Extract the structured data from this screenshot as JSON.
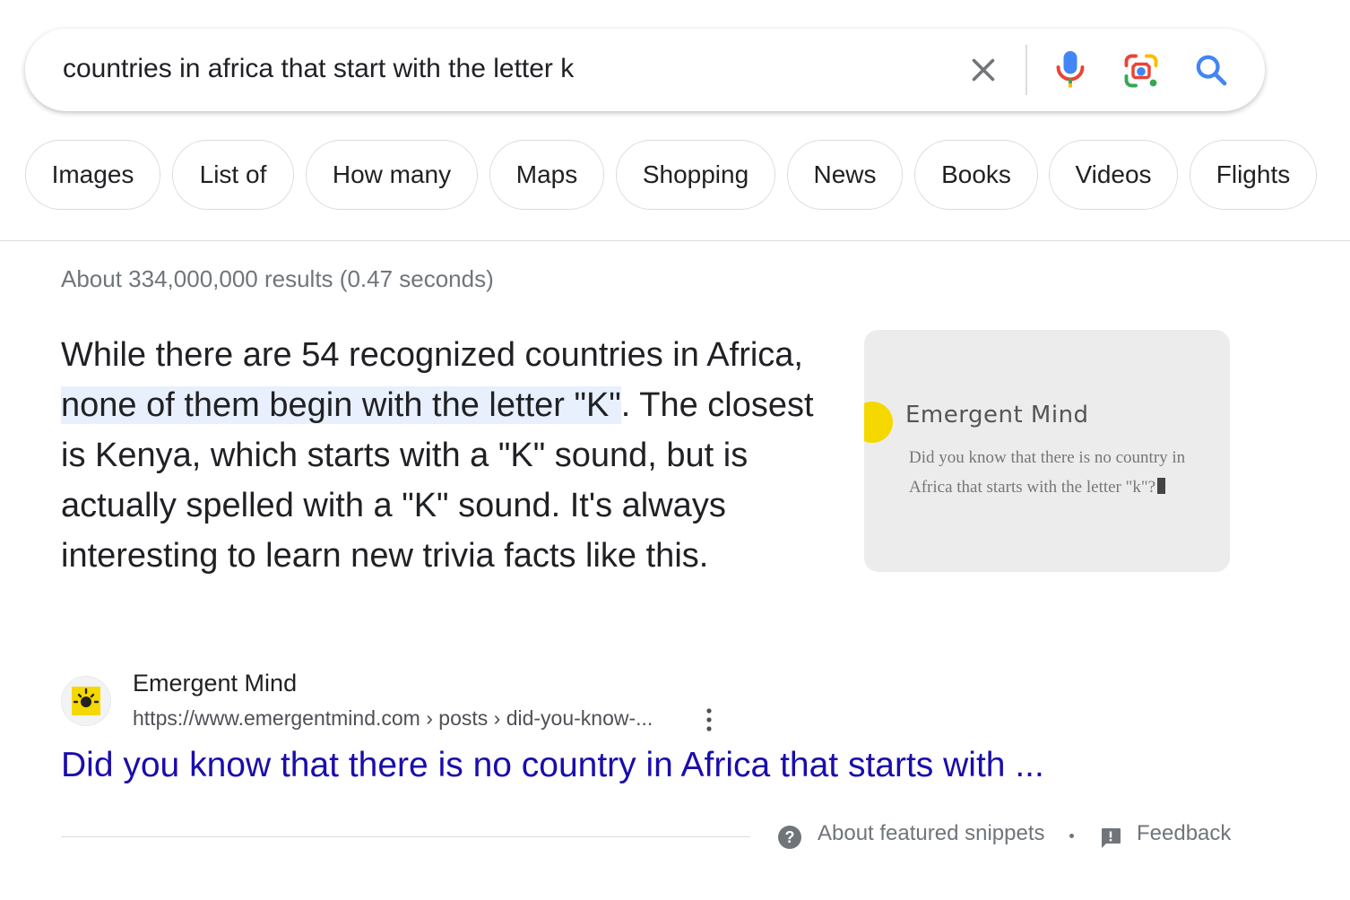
{
  "search": {
    "query": "countries in africa that start with the letter k"
  },
  "chips": [
    {
      "label": "Images"
    },
    {
      "label": "List of"
    },
    {
      "label": "How many"
    },
    {
      "label": "Maps"
    },
    {
      "label": "Shopping"
    },
    {
      "label": "News"
    },
    {
      "label": "Books"
    },
    {
      "label": "Videos"
    },
    {
      "label": "Flights"
    }
  ],
  "results_stats": "About 334,000,000 results (0.47 seconds)",
  "snippet": {
    "text_before": "While there are 54 recognized countries in Africa, ",
    "text_highlight": "none of them begin with the letter \"K\"",
    "text_after": ". The closest is Kenya, which starts with a \"K\" sound, but is actually spelled with a \"K\" sound. It's always interesting to learn new trivia facts like this."
  },
  "thumbnail": {
    "title": "Emergent Mind",
    "text_line1": "Did you know that there is no country in",
    "text_line2": "Africa that starts with the letter \"k\"?"
  },
  "source": {
    "site_name": "Emergent Mind",
    "url": "https://www.emergentmind.com › posts › did-you-know-...",
    "title": "Did you know that there is no country in Africa that starts with ..."
  },
  "footer": {
    "about_label": "About featured snippets",
    "feedback_label": "Feedback"
  },
  "colors": {
    "link": "#1a0dab",
    "highlight": "#e8f0fe",
    "secondary_text": "#70757a"
  }
}
